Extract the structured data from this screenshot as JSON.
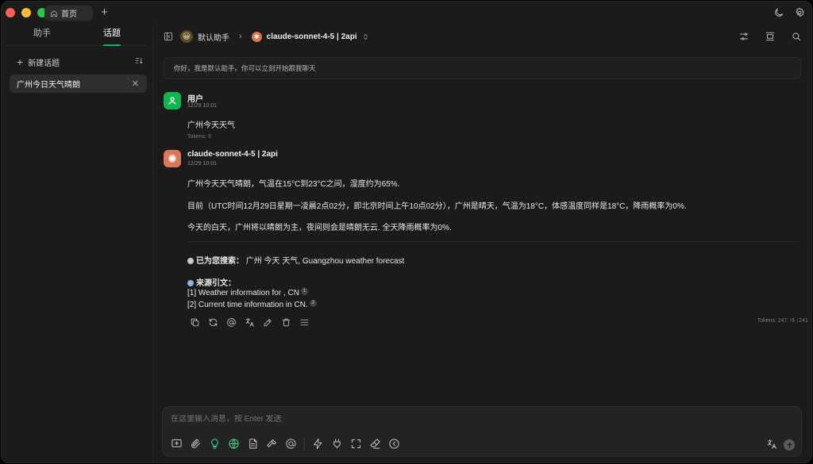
{
  "window": {
    "home_tab_label": "首页"
  },
  "sidebar": {
    "tabs": [
      {
        "label": "助手",
        "active": false
      },
      {
        "label": "话题",
        "active": true
      }
    ],
    "new_topic_label": "新建话题",
    "topics": [
      {
        "label": "广州今日天气晴朗",
        "selected": true
      }
    ]
  },
  "header": {
    "assistant_name": "默认助手",
    "assistant_emoji": "😀",
    "model_name": "claude-sonnet-4-5 | 2api"
  },
  "chat": {
    "welcome": "你好，我是默认助手。你可以立刻开始跟我聊天",
    "messages": [
      {
        "role": "user",
        "name": "用户",
        "time": "12/29 10:01",
        "text": "广州今天天气",
        "tokens": "Tokens: 6"
      },
      {
        "role": "assistant",
        "name": "claude-sonnet-4-5 | 2api",
        "time": "12/29 10:01",
        "paragraphs": [
          "广州今天天气晴朗，气温在15°C到23°C之间，湿度约为65%.",
          "目前（UTC时间12月29日星期一凌晨2点02分，即北京时间上午10点02分），广州是晴天，气温为18°C，体感温度同样是18°C，降雨概率为0%.",
          "今天的白天，广州将以晴朗为主，夜间则会是晴朗无云. 全天降雨概率为0%."
        ],
        "search_label": "已为您搜索：",
        "search_query": "广州 今天 天气, Guangzhou weather forecast",
        "citations_label": "来源引文：",
        "citations": [
          {
            "text": "[1] Weather information for , CN",
            "num": "1"
          },
          {
            "text": "[2] Current time information in CN.",
            "num": "2"
          }
        ],
        "tokens": "Tokens: 247 ↑6 ↓241"
      }
    ]
  },
  "input": {
    "placeholder": "在这里输入消息，按 Enter 发送"
  },
  "colors": {
    "accent": "#00b96b",
    "user_avatar": "#10b54f",
    "assistant_avatar": "#d97757"
  }
}
